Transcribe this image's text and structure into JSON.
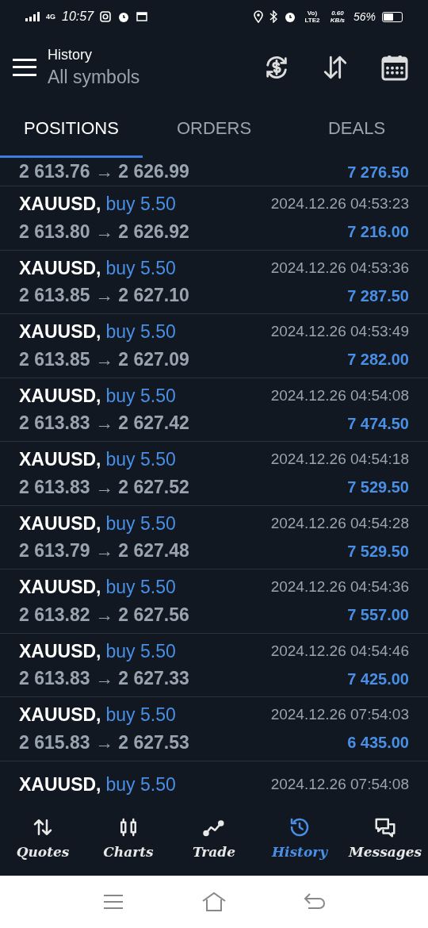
{
  "status_bar": {
    "network": "4G",
    "time": "10:57",
    "volte": "Vo) LTE2",
    "speed": "0.60 KB/s",
    "battery": "56%"
  },
  "header": {
    "title": "History",
    "subtitle": "All symbols"
  },
  "tabs": [
    {
      "label": "POSITIONS",
      "selected": true
    },
    {
      "label": "ORDERS",
      "selected": false
    },
    {
      "label": "DEALS",
      "selected": false
    }
  ],
  "rows": [
    {
      "prices": "2 613.76 → 2 626.99",
      "profit": "7 276.50"
    },
    {
      "symbol": "XAUUSD,",
      "side": "buy 5.50",
      "time": "2024.12.26 04:53:23",
      "prices": "2 613.80 → 2 626.92",
      "profit": "7 216.00"
    },
    {
      "symbol": "XAUUSD,",
      "side": "buy 5.50",
      "time": "2024.12.26 04:53:36",
      "prices": "2 613.85 → 2 627.10",
      "profit": "7 287.50"
    },
    {
      "symbol": "XAUUSD,",
      "side": "buy 5.50",
      "time": "2024.12.26 04:53:49",
      "prices": "2 613.85 → 2 627.09",
      "profit": "7 282.00"
    },
    {
      "symbol": "XAUUSD,",
      "side": "buy 5.50",
      "time": "2024.12.26 04:54:08",
      "prices": "2 613.83 → 2 627.42",
      "profit": "7 474.50"
    },
    {
      "symbol": "XAUUSD,",
      "side": "buy 5.50",
      "time": "2024.12.26 04:54:18",
      "prices": "2 613.83 → 2 627.52",
      "profit": "7 529.50"
    },
    {
      "symbol": "XAUUSD,",
      "side": "buy 5.50",
      "time": "2024.12.26 04:54:28",
      "prices": "2 613.79 → 2 627.48",
      "profit": "7 529.50"
    },
    {
      "symbol": "XAUUSD,",
      "side": "buy 5.50",
      "time": "2024.12.26 04:54:36",
      "prices": "2 613.82 → 2 627.56",
      "profit": "7 557.00"
    },
    {
      "symbol": "XAUUSD,",
      "side": "buy 5.50",
      "time": "2024.12.26 04:54:46",
      "prices": "2 613.83 → 2 627.33",
      "profit": "7 425.00"
    },
    {
      "symbol": "XAUUSD,",
      "side": "buy 5.50",
      "time": "2024.12.26 07:54:03",
      "prices": "2 615.83 → 2 627.53",
      "profit": "6 435.00"
    },
    {
      "symbol": "XAUUSD,",
      "side": "buy 5.50",
      "time": "2024.12.26 07:54:08"
    }
  ],
  "bottom_nav": [
    {
      "kind": "quotes",
      "label": "Quotes",
      "selected": false
    },
    {
      "kind": "charts",
      "label": "Charts",
      "selected": false
    },
    {
      "kind": "trade",
      "label": "Trade",
      "selected": false
    },
    {
      "kind": "history",
      "label": "History",
      "selected": true
    },
    {
      "kind": "messages",
      "label": "Messages",
      "selected": false
    }
  ]
}
